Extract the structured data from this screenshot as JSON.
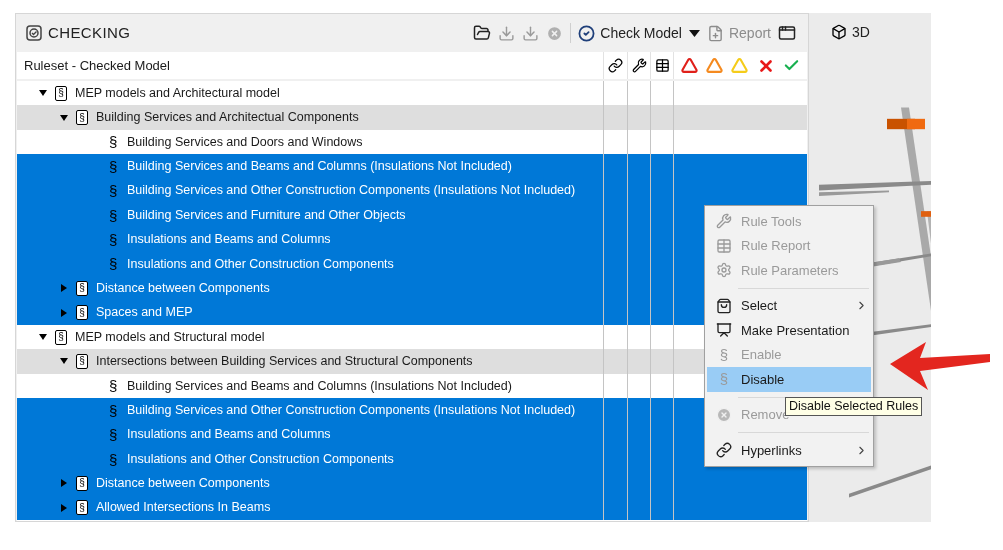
{
  "panel": {
    "title": "CHECKING",
    "toolbar": {
      "check_model": {
        "label": "Check Model"
      },
      "report": {
        "label": "Report",
        "disabled": true
      }
    },
    "columns": {
      "ruleset": "Ruleset - Checked Model"
    },
    "tree": [
      {
        "label": "MEP models and Architectural model",
        "mark": "§",
        "kind": "ruleset",
        "expanded": true,
        "selected": false,
        "children": [
          {
            "label": "Building Services and Architectual Components",
            "mark": "§",
            "kind": "ruleset",
            "expanded": true,
            "selected": false,
            "children": [
              {
                "label": "Building Services and Doors and Windows",
                "mark": "§",
                "kind": "rule",
                "selected": false
              },
              {
                "label": "Building Services and Beams and Columns (Insulations Not Included)",
                "mark": "§",
                "kind": "rule",
                "selected": true
              },
              {
                "label": "Building Services and Other Construction Components (Insulations Not Included)",
                "mark": "§",
                "kind": "rule",
                "selected": true
              },
              {
                "label": "Building Services and Furniture and Other Objects",
                "mark": "§",
                "kind": "rule",
                "selected": true
              },
              {
                "label": "Insulations and Beams and Columns",
                "mark": "§",
                "kind": "rule",
                "selected": true
              },
              {
                "label": "Insulations and Other Construction Components",
                "mark": "§",
                "kind": "rule",
                "selected": true
              }
            ]
          },
          {
            "label": "Distance between Components",
            "mark": "§",
            "kind": "ruleset",
            "expanded": false,
            "selected": true
          },
          {
            "label": "Spaces and MEP",
            "mark": "§",
            "kind": "ruleset",
            "expanded": false,
            "selected": true
          }
        ]
      },
      {
        "label": "MEP models and Structural model",
        "mark": "§",
        "kind": "ruleset",
        "expanded": true,
        "selected": false,
        "children": [
          {
            "label": "Intersections between Building Services and Structural Components",
            "mark": "§",
            "kind": "ruleset",
            "expanded": true,
            "selected": false,
            "children": [
              {
                "label": "Building Services and Beams and Columns (Insulations Not Included)",
                "mark": "§",
                "kind": "rule",
                "selected": false
              },
              {
                "label": "Building Services and Other Construction Components (Insulations Not Included)",
                "mark": "§",
                "kind": "rule",
                "selected": true
              },
              {
                "label": "Insulations and Beams and Columns",
                "mark": "§",
                "kind": "rule",
                "selected": true
              },
              {
                "label": "Insulations and Other Construction Components",
                "mark": "§",
                "kind": "rule",
                "selected": true
              }
            ]
          },
          {
            "label": "Distance between Components",
            "mark": "§",
            "kind": "ruleset",
            "expanded": false,
            "selected": true
          },
          {
            "label": "Allowed Intersections In Beams",
            "mark": "§",
            "kind": "ruleset",
            "expanded": false,
            "selected": true
          }
        ]
      }
    ]
  },
  "view": {
    "tab": "3D"
  },
  "context_menu": {
    "items": [
      {
        "kind": "item",
        "label": "Rule Tools",
        "disabled": true,
        "selected": false,
        "submenu": false
      },
      {
        "kind": "item",
        "label": "Rule Report",
        "disabled": true,
        "selected": false,
        "submenu": false
      },
      {
        "kind": "item",
        "label": "Rule Parameters",
        "disabled": true,
        "selected": false,
        "submenu": false
      },
      {
        "kind": "separator"
      },
      {
        "kind": "item",
        "label": "Select",
        "disabled": false,
        "selected": false,
        "submenu": true
      },
      {
        "kind": "item",
        "label": "Make Presentation",
        "disabled": false,
        "selected": false,
        "submenu": false
      },
      {
        "kind": "item",
        "label": "Enable",
        "mark": "§",
        "disabled": true,
        "selected": false,
        "submenu": false
      },
      {
        "kind": "item",
        "label": "Disable",
        "mark": "§",
        "disabled": false,
        "selected": true,
        "submenu": false
      },
      {
        "kind": "separator"
      },
      {
        "kind": "item",
        "label": "Remove",
        "disabled": true,
        "selected": false,
        "submenu": false
      },
      {
        "kind": "separator"
      },
      {
        "kind": "item",
        "label": "Hyperlinks",
        "disabled": false,
        "selected": false,
        "submenu": true
      }
    ]
  },
  "tooltip": "Disable Selected Rules"
}
